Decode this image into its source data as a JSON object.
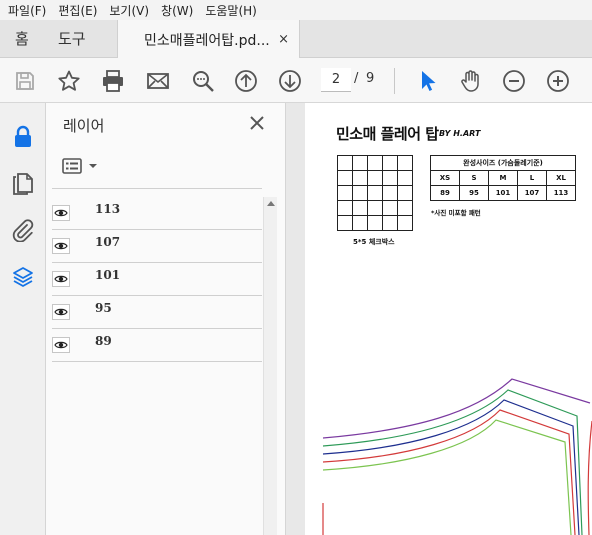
{
  "menu": [
    "파일(F)",
    "편집(E)",
    "보기(V)",
    "창(W)",
    "도움말(H)"
  ],
  "tabs": {
    "home": "홈",
    "tools": "도구",
    "document": "민소매플레어탑.pd...",
    "close": "×"
  },
  "toolbar": {
    "current_page": "2",
    "separator": "/",
    "page_count": "9",
    "icons": [
      "save-icon",
      "star-icon",
      "print-icon",
      "mail-icon",
      "zoom-search-icon",
      "arrow-up-icon",
      "arrow-down-icon",
      "select-cursor-icon",
      "hand-icon",
      "zoom-out-icon",
      "zoom-in-icon"
    ]
  },
  "rail": {
    "icons": [
      "lock-icon",
      "pages-icon",
      "attachment-icon",
      "layers-icon"
    ],
    "active": "layers-icon"
  },
  "panel": {
    "title": "레이어",
    "layers": [
      {
        "name": "113"
      },
      {
        "name": "107"
      },
      {
        "name": "101"
      },
      {
        "name": "95"
      },
      {
        "name": "89"
      }
    ]
  },
  "document": {
    "title": "민소매 플레어 탑",
    "brand": "BY H.ART",
    "grid_caption": "5*5 체크박스",
    "size_table": {
      "heading": "완성사이즈 (가슴둘레기준)",
      "sizes": [
        "XS",
        "S",
        "M",
        "L",
        "XL"
      ],
      "values": [
        "89",
        "95",
        "101",
        "107",
        "113"
      ]
    },
    "note": "*사진 미포함 패턴",
    "pattern_colors": {
      "89": "#7cc450",
      "95": "#d33a3a",
      "101": "#1e2f8f",
      "107": "#2e9a58",
      "113": "#7a3aa0"
    }
  },
  "colors": {
    "accent": "#1473e6"
  }
}
